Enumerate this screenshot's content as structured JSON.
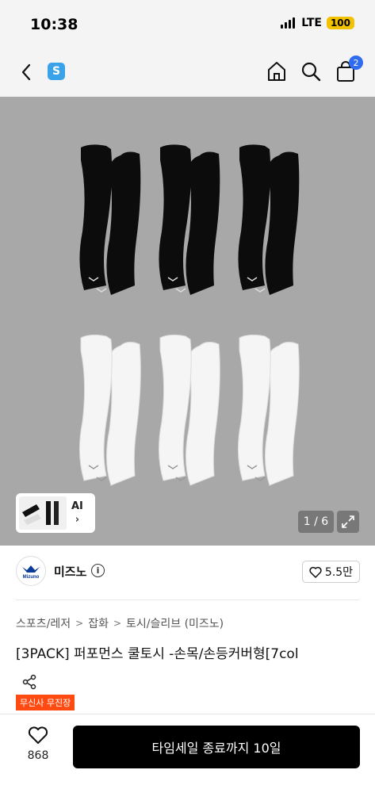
{
  "status_bar": {
    "time": "10:38",
    "network": "LTE",
    "battery": "100"
  },
  "header": {
    "store_badge": "S",
    "cart_count": "2"
  },
  "gallery": {
    "ai_label": "AI",
    "ai_arrow": "›",
    "page_counter": "1 / 6"
  },
  "brand": {
    "name": "미즈노",
    "logo_text": "Mizuno",
    "like_count": "5.5만"
  },
  "breadcrumb": {
    "items": [
      "스포츠/레저",
      "잡화",
      "토시/슬리브 (미즈노)"
    ],
    "separator": ">"
  },
  "product": {
    "title": "[3PACK] 퍼포먼스 쿨토시 -손목/손등커버형[7col",
    "promo_badge": "무신사 무진장"
  },
  "bottom_bar": {
    "wish_count": "868",
    "buy_label": "타임세일 종료까지 10일"
  },
  "colors": {
    "accent_blue": "#2f6cf0",
    "store_badge": "#3aa2e8",
    "promo_orange": "#ff4b12",
    "battery_yellow": "#f2c200",
    "image_bg": "#a8a8a8"
  }
}
